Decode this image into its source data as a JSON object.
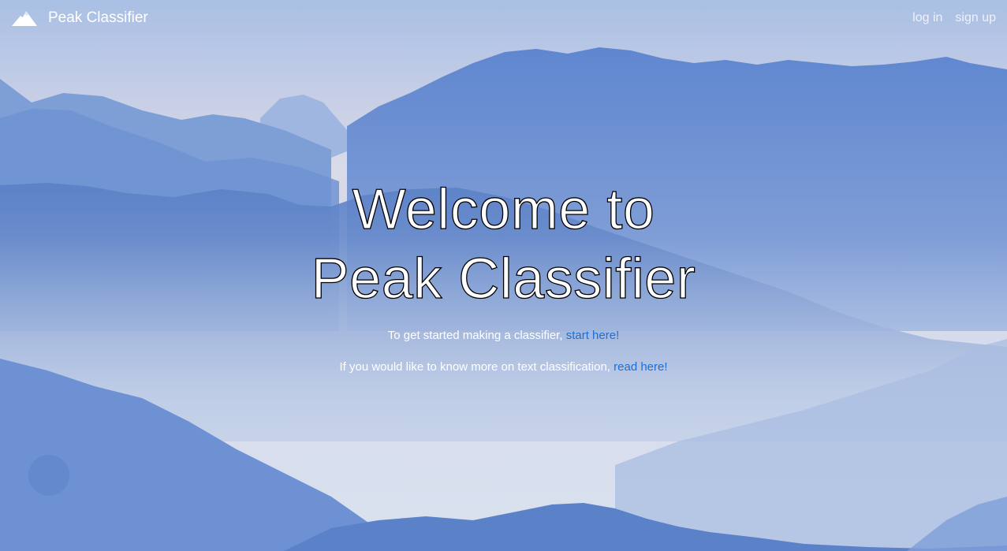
{
  "navbar": {
    "brand_icon": "mountain-peak-icon",
    "brand_label": "Peak Classifier",
    "login_label": "log in",
    "signup_label": "sign up"
  },
  "hero": {
    "title_line1": "Welcome to",
    "title_line2": "Peak Classifier",
    "start_text": "To get started making a classifier,",
    "start_link": "start here!",
    "read_text": "If you would like to know more on text classification,",
    "read_link": "read here!"
  },
  "colors": {
    "link": "#1a6fd8",
    "sky_top": "#b9c6e3",
    "mountain_dark": "#4f78c4"
  }
}
